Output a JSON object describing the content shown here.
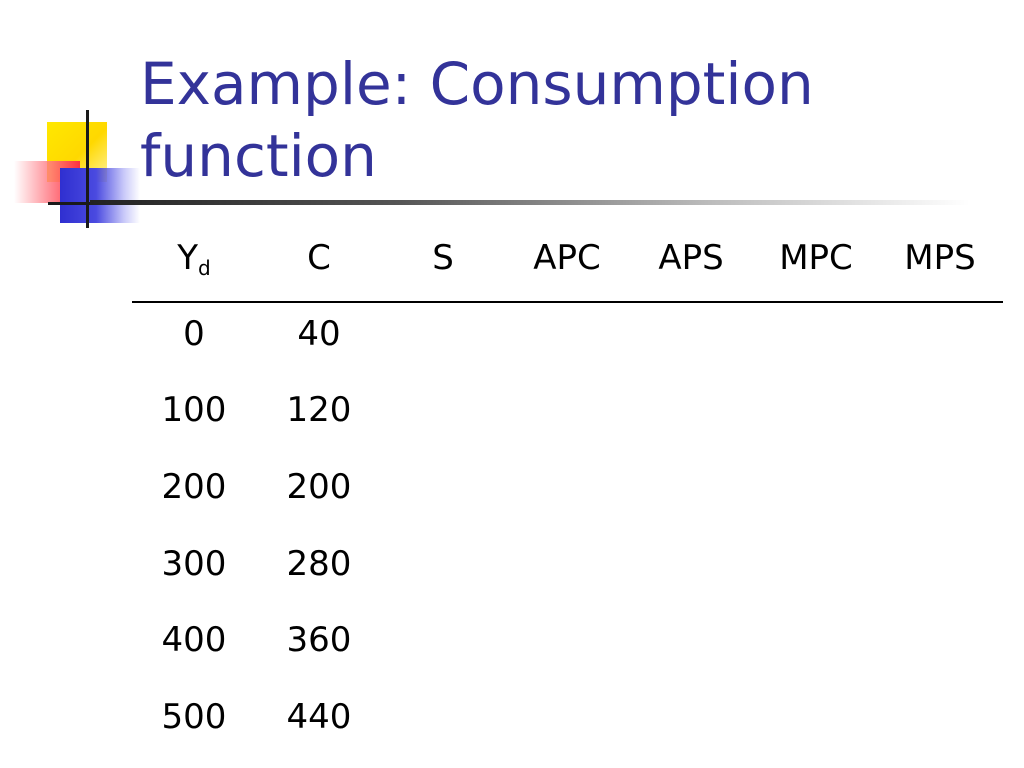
{
  "slide": {
    "title_line1": "Example: Consumption",
    "title_line2": "function"
  },
  "table": {
    "headers": [
      {
        "main": "Y",
        "sub": "d"
      },
      {
        "main": "C"
      },
      {
        "main": "S"
      },
      {
        "main": "APC"
      },
      {
        "main": "APS"
      },
      {
        "main": "MPC"
      },
      {
        "main": "MPS"
      }
    ],
    "rows": [
      [
        "0",
        "40"
      ],
      [
        "100",
        "120"
      ],
      [
        "200",
        "200"
      ],
      [
        "300",
        "280"
      ],
      [
        "400",
        "360"
      ],
      [
        "500",
        "440"
      ]
    ]
  }
}
